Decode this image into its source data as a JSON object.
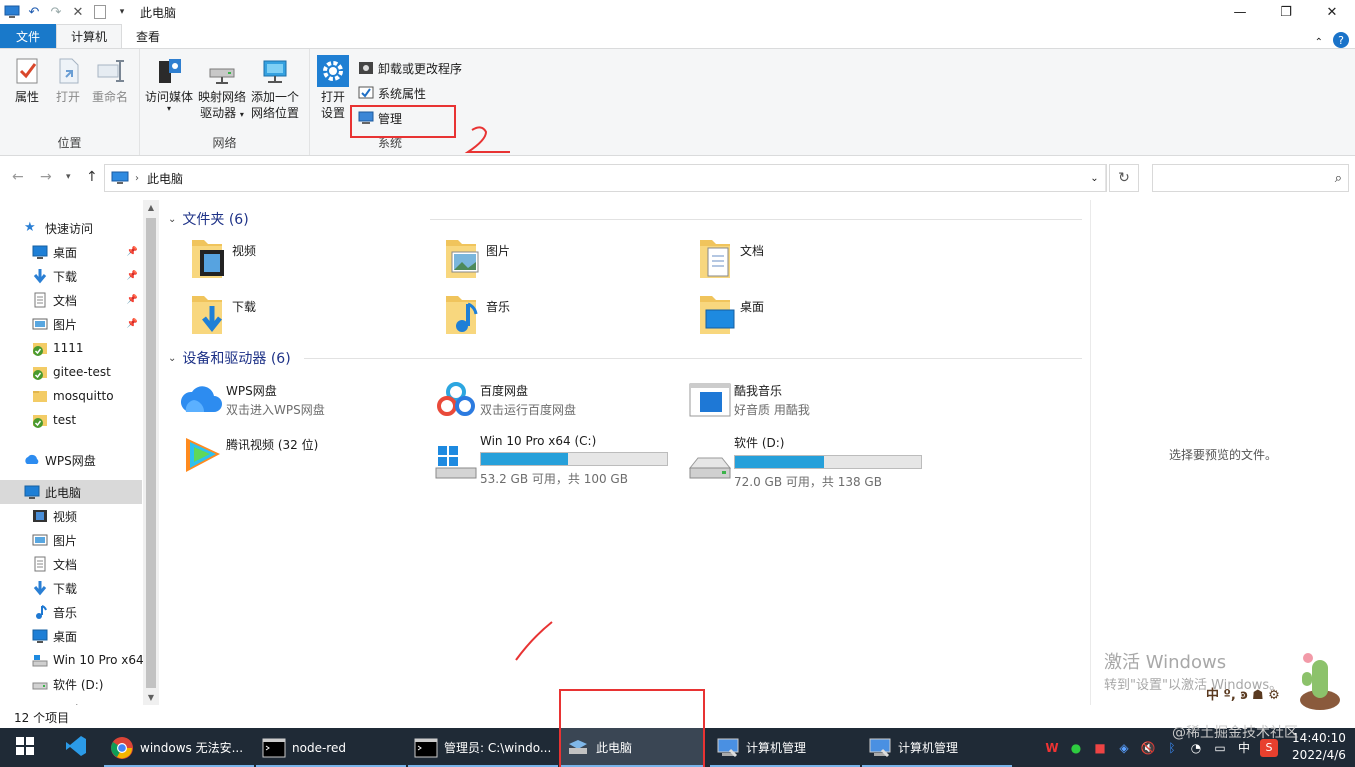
{
  "window": {
    "title": "此电脑",
    "quick_access_icons": [
      "computer-icon",
      "undo-icon",
      "redo-icon",
      "delete-icon",
      "new-folder-icon",
      "qat-dropdown-icon"
    ]
  },
  "ribbon_tabs": {
    "file": "文件",
    "computer": "计算机",
    "view": "查看"
  },
  "ribbon": {
    "location": {
      "label": "位置",
      "properties": "属性",
      "open": "打开",
      "rename": "重命名"
    },
    "network": {
      "label": "网络",
      "access_media": "访问媒体",
      "map_drive_line1": "映射网络",
      "map_drive_line2": "驱动器",
      "add_location_line1": "添加一个",
      "add_location_line2": "网络位置"
    },
    "system": {
      "label": "系统",
      "open_settings_line1": "打开",
      "open_settings_line2": "设置",
      "uninstall": "卸载或更改程序",
      "system_properties": "系统属性",
      "manage": "管理"
    }
  },
  "address": {
    "path": "此电脑"
  },
  "nav_pane": {
    "quick_access": "快速访问",
    "quick_items": [
      {
        "label": "桌面",
        "icon": "desktop-icon",
        "pinned": true
      },
      {
        "label": "下载",
        "icon": "download-icon",
        "pinned": true
      },
      {
        "label": "文档",
        "icon": "document-icon",
        "pinned": true
      },
      {
        "label": "图片",
        "icon": "picture-icon",
        "pinned": true
      },
      {
        "label": "1111",
        "icon": "synced-folder-icon",
        "pinned": false
      },
      {
        "label": "gitee-test",
        "icon": "synced-folder-icon",
        "pinned": false
      },
      {
        "label": "mosquitto",
        "icon": "folder-icon",
        "pinned": false
      },
      {
        "label": "test",
        "icon": "synced-folder-icon",
        "pinned": false
      }
    ],
    "wps": "WPS网盘",
    "this_pc": "此电脑",
    "pc_items": [
      {
        "label": "视频",
        "icon": "video-icon"
      },
      {
        "label": "图片",
        "icon": "picture-icon"
      },
      {
        "label": "文档",
        "icon": "document-icon"
      },
      {
        "label": "下载",
        "icon": "download-icon"
      },
      {
        "label": "音乐",
        "icon": "music-icon"
      },
      {
        "label": "桌面",
        "icon": "desktop-icon"
      },
      {
        "label": "Win 10 Pro x64",
        "icon": "drive-c-icon"
      },
      {
        "label": "软件 (D:)",
        "icon": "drive-icon"
      }
    ],
    "network_partial": "Network"
  },
  "content": {
    "folders_header": "文件夹 (6)",
    "folders": [
      {
        "name": "视频",
        "icon": "video-folder-icon"
      },
      {
        "name": "图片",
        "icon": "picture-folder-icon"
      },
      {
        "name": "文档",
        "icon": "document-folder-icon"
      },
      {
        "name": "下载",
        "icon": "download-folder-icon"
      },
      {
        "name": "音乐",
        "icon": "music-folder-icon"
      },
      {
        "name": "桌面",
        "icon": "desktop-folder-icon"
      }
    ],
    "devices_header": "设备和驱动器 (6)",
    "devices": [
      {
        "name": "WPS网盘",
        "sub": "双击进入WPS网盘",
        "icon": "wps-cloud-icon"
      },
      {
        "name": "百度网盘",
        "sub": "双击运行百度网盘",
        "icon": "baidu-netdisk-icon"
      },
      {
        "name": "酷我音乐",
        "sub": "好音质 用酷我",
        "icon": "kuwo-music-icon"
      },
      {
        "name": "腾讯视频 (32 位)",
        "sub": "",
        "icon": "tencent-video-icon"
      }
    ],
    "drives": [
      {
        "name": "Win 10 Pro x64 (C:)",
        "free_text": "53.2 GB 可用，共 100 GB",
        "used_fraction": 0.468,
        "icon": "windows-drive-icon"
      },
      {
        "name": "软件 (D:)",
        "free_text": "72.0 GB 可用，共 138 GB",
        "used_fraction": 0.478,
        "icon": "drive-icon"
      }
    ]
  },
  "preview": {
    "message": "选择要预览的文件。"
  },
  "status": {
    "count": "12 个项目"
  },
  "taskbar": {
    "items": [
      {
        "label": "windows 无法安...",
        "icon": "chrome-icon"
      },
      {
        "label": "node-red",
        "icon": "cmd-icon"
      },
      {
        "label": "管理员: C:\\windo...",
        "icon": "cmd-icon"
      },
      {
        "label": "此电脑",
        "icon": "explorer-icon"
      },
      {
        "label": "计算机管理",
        "icon": "computer-management-icon"
      },
      {
        "label": "计算机管理",
        "icon": "computer-management-icon"
      }
    ],
    "tray_ime": "中",
    "clock_time": "14:40:10",
    "clock_date": "2022/4/6"
  },
  "overlay": {
    "activate_title": "激活 Windows",
    "activate_sub": "转到\"设置\"以激活 Windows。",
    "watermark": "@稀土掘金技术社区",
    "annotation_1": "1",
    "annotation_2": "2"
  },
  "colors": {
    "accent": "#1979ca",
    "selection": "#cce8ff",
    "drive_bar": "#26a0da",
    "taskbar": "#1f2a36",
    "annotation_red": "#e83333"
  }
}
